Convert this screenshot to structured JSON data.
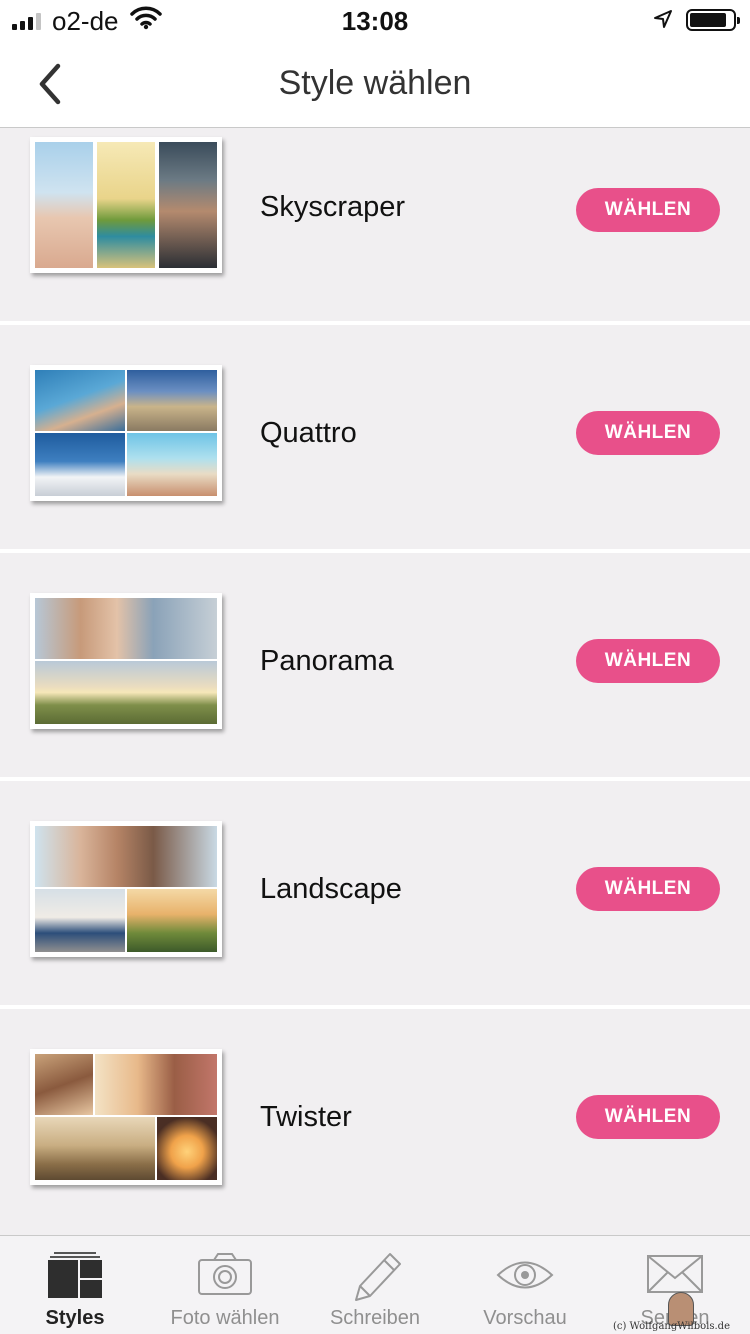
{
  "status_bar": {
    "carrier": "o2-de",
    "time": "13:08"
  },
  "nav": {
    "title": "Style wählen"
  },
  "styles": [
    {
      "name": "Skyscraper",
      "button": "WÄHLEN"
    },
    {
      "name": "Quattro",
      "button": "WÄHLEN"
    },
    {
      "name": "Panorama",
      "button": "WÄHLEN"
    },
    {
      "name": "Landscape",
      "button": "WÄHLEN"
    },
    {
      "name": "Twister",
      "button": "WÄHLEN"
    }
  ],
  "tabs": [
    {
      "label": "Styles",
      "icon": "styles-icon",
      "active": true
    },
    {
      "label": "Foto wählen",
      "icon": "camera-icon"
    },
    {
      "label": "Schreiben",
      "icon": "pencil-icon"
    },
    {
      "label": "Vorschau",
      "icon": "eye-icon"
    },
    {
      "label": "Senden",
      "icon": "envelope-icon"
    }
  ],
  "watermark": "(c) WolfgangWilbois.de",
  "colors": {
    "accent": "#e8508a",
    "background": "#f1eff1"
  }
}
